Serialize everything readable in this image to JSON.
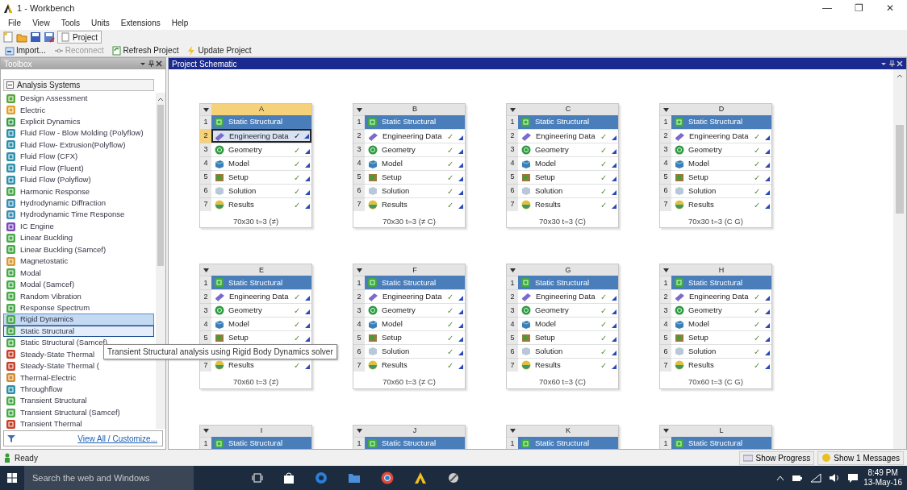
{
  "window": {
    "title": "1 - Workbench",
    "controls": [
      "—",
      "❐",
      "✕"
    ]
  },
  "menu": [
    "File",
    "View",
    "Tools",
    "Units",
    "Extensions",
    "Help"
  ],
  "toolbar": {
    "tab": "Project"
  },
  "project_toolbar": [
    {
      "label": "Import...",
      "disabled": false
    },
    {
      "label": "Reconnect",
      "disabled": true
    },
    {
      "label": "Refresh Project",
      "disabled": false
    },
    {
      "label": "Update Project",
      "disabled": false
    }
  ],
  "toolbox": {
    "title": "Toolbox",
    "group": "Analysis Systems",
    "items": [
      {
        "label": "Design Assessment",
        "color": "#5aa83c",
        "selected": false,
        "hovered": false
      },
      {
        "label": "Electric",
        "color": "#e0a030",
        "selected": false,
        "hovered": false
      },
      {
        "label": "Explicit Dynamics",
        "color": "#3c9a4a",
        "selected": false,
        "hovered": false
      },
      {
        "label": "Fluid Flow - Blow Molding (Polyflow)",
        "color": "#2f8fa8",
        "selected": false,
        "hovered": false
      },
      {
        "label": "Fluid Flow- Extrusion(Polyflow)",
        "color": "#2f8fa8",
        "selected": false,
        "hovered": false
      },
      {
        "label": "Fluid Flow (CFX)",
        "color": "#2f8fa8",
        "selected": false,
        "hovered": false
      },
      {
        "label": "Fluid Flow (Fluent)",
        "color": "#2f8fa8",
        "selected": false,
        "hovered": false
      },
      {
        "label": "Fluid Flow (Polyflow)",
        "color": "#2f8fa8",
        "selected": false,
        "hovered": false
      },
      {
        "label": "Harmonic Response",
        "color": "#4aa84a",
        "selected": false,
        "hovered": false
      },
      {
        "label": "Hydrodynamic Diffraction",
        "color": "#3a8fb0",
        "selected": false,
        "hovered": false
      },
      {
        "label": "Hydrodynamic Time Response",
        "color": "#3a8fb0",
        "selected": false,
        "hovered": false
      },
      {
        "label": "IC Engine",
        "color": "#7a4ab8",
        "selected": false,
        "hovered": false
      },
      {
        "label": "Linear Buckling",
        "color": "#4aa84a",
        "selected": false,
        "hovered": false
      },
      {
        "label": "Linear Buckling (Samcef)",
        "color": "#4aa84a",
        "selected": false,
        "hovered": false
      },
      {
        "label": "Magnetostatic",
        "color": "#d89a38",
        "selected": false,
        "hovered": false
      },
      {
        "label": "Modal",
        "color": "#4aa84a",
        "selected": false,
        "hovered": false
      },
      {
        "label": "Modal (Samcef)",
        "color": "#4aa84a",
        "selected": false,
        "hovered": false
      },
      {
        "label": "Random Vibration",
        "color": "#4aa84a",
        "selected": false,
        "hovered": false
      },
      {
        "label": "Response Spectrum",
        "color": "#4aa84a",
        "selected": false,
        "hovered": false
      },
      {
        "label": "Rigid Dynamics",
        "color": "#4aa84a",
        "selected": false,
        "hovered": true
      },
      {
        "label": "Static Structural",
        "color": "#4aa84a",
        "selected": true,
        "hovered": false
      },
      {
        "label": "Static Structural (Samcef)",
        "color": "#4aa84a",
        "selected": false,
        "hovered": false
      },
      {
        "label": "Steady-State Thermal",
        "color": "#c8402a",
        "selected": false,
        "hovered": false
      },
      {
        "label": "Steady-State Thermal (",
        "color": "#c8402a",
        "selected": false,
        "hovered": false
      },
      {
        "label": "Thermal-Electric",
        "color": "#d08a30",
        "selected": false,
        "hovered": false
      },
      {
        "label": "Throughflow",
        "color": "#2f8fa8",
        "selected": false,
        "hovered": false
      },
      {
        "label": "Transient Structural",
        "color": "#4aa84a",
        "selected": false,
        "hovered": false
      },
      {
        "label": "Transient Structural (Samcef)",
        "color": "#4aa84a",
        "selected": false,
        "hovered": false
      },
      {
        "label": "Transient Thermal",
        "color": "#c8402a",
        "selected": false,
        "hovered": false
      }
    ],
    "footer": "View All / Customize...",
    "tooltip": "Transient Structural analysis using Rigid Body Dynamics solver"
  },
  "schematic": {
    "title": "Project Schematic",
    "systems": [
      {
        "column": "A",
        "selected": true,
        "caption": "70x30 t=3 (≠)",
        "cells": [
          {
            "number": "1",
            "label": "Static Structural",
            "kind": "title",
            "selected": false
          },
          {
            "number": "2",
            "label": "Engineering Data",
            "status": "✓",
            "kind": "engineering_data",
            "selected": true
          },
          {
            "number": "3",
            "label": "Geometry",
            "status": "✓",
            "kind": "geometry",
            "selected": false
          },
          {
            "number": "4",
            "label": "Model",
            "status": "✓",
            "kind": "model",
            "selected": false
          },
          {
            "number": "5",
            "label": "Setup",
            "status": "✓",
            "kind": "setup",
            "selected": false
          },
          {
            "number": "6",
            "label": "Solution",
            "status": "✓",
            "kind": "solution",
            "selected": false
          },
          {
            "number": "7",
            "label": "Results",
            "status": "✓",
            "kind": "results",
            "selected": false
          }
        ]
      },
      {
        "column": "B",
        "selected": false,
        "caption": "70x30 t=3 (≠ C)",
        "cells": [
          {
            "number": "1",
            "label": "Static Structural",
            "kind": "title",
            "selected": false
          },
          {
            "number": "2",
            "label": "Engineering Data",
            "status": "✓",
            "kind": "engineering_data",
            "selected": false
          },
          {
            "number": "3",
            "label": "Geometry",
            "status": "✓",
            "kind": "geometry",
            "selected": false
          },
          {
            "number": "4",
            "label": "Model",
            "status": "✓",
            "kind": "model",
            "selected": false
          },
          {
            "number": "5",
            "label": "Setup",
            "status": "✓",
            "kind": "setup",
            "selected": false
          },
          {
            "number": "6",
            "label": "Solution",
            "status": "✓",
            "kind": "solution",
            "selected": false
          },
          {
            "number": "7",
            "label": "Results",
            "status": "✓",
            "kind": "results",
            "selected": false
          }
        ]
      },
      {
        "column": "C",
        "selected": false,
        "caption": "70x30 t=3 (C)",
        "cells": [
          {
            "number": "1",
            "label": "Static Structural",
            "kind": "title",
            "selected": false
          },
          {
            "number": "2",
            "label": "Engineering Data",
            "status": "✓",
            "kind": "engineering_data",
            "selected": false
          },
          {
            "number": "3",
            "label": "Geometry",
            "status": "✓",
            "kind": "geometry",
            "selected": false
          },
          {
            "number": "4",
            "label": "Model",
            "status": "✓",
            "kind": "model",
            "selected": false
          },
          {
            "number": "5",
            "label": "Setup",
            "status": "✓",
            "kind": "setup",
            "selected": false
          },
          {
            "number": "6",
            "label": "Solution",
            "status": "✓",
            "kind": "solution",
            "selected": false
          },
          {
            "number": "7",
            "label": "Results",
            "status": "✓",
            "kind": "results",
            "selected": false
          }
        ]
      },
      {
        "column": "D",
        "selected": false,
        "caption": "70x30 t=3 (C G)",
        "cells": [
          {
            "number": "1",
            "label": "Static Structural",
            "kind": "title",
            "selected": false
          },
          {
            "number": "2",
            "label": "Engineering Data",
            "status": "✓",
            "kind": "engineering_data",
            "selected": false
          },
          {
            "number": "3",
            "label": "Geometry",
            "status": "✓",
            "kind": "geometry",
            "selected": false
          },
          {
            "number": "4",
            "label": "Model",
            "status": "✓",
            "kind": "model",
            "selected": false
          },
          {
            "number": "5",
            "label": "Setup",
            "status": "✓",
            "kind": "setup",
            "selected": false
          },
          {
            "number": "6",
            "label": "Solution",
            "status": "✓",
            "kind": "solution",
            "selected": false
          },
          {
            "number": "7",
            "label": "Results",
            "status": "✓",
            "kind": "results",
            "selected": false
          }
        ]
      },
      {
        "column": "E",
        "selected": false,
        "caption": "70x60 t=3 (≠)",
        "cells": [
          {
            "number": "1",
            "label": "Static Structural",
            "kind": "title",
            "selected": false
          },
          {
            "number": "2",
            "label": "Engineering Data",
            "status": "✓",
            "kind": "engineering_data",
            "selected": false
          },
          {
            "number": "3",
            "label": "Geometry",
            "status": "✓",
            "kind": "geometry",
            "selected": false
          },
          {
            "number": "4",
            "label": "Model",
            "status": "✓",
            "kind": "model",
            "selected": false
          },
          {
            "number": "5",
            "label": "Setup",
            "status": "✓",
            "kind": "setup",
            "selected": false
          },
          {
            "kind": "covered"
          },
          {
            "number": "7",
            "label": "Results",
            "status": "✓",
            "kind": "results",
            "selected": false
          }
        ]
      },
      {
        "column": "F",
        "selected": false,
        "caption": "70x60 t=3 (≠ C)",
        "cells": [
          {
            "number": "1",
            "label": "Static Structural",
            "kind": "title",
            "selected": false
          },
          {
            "number": "2",
            "label": "Engineering Data",
            "status": "✓",
            "kind": "engineering_data",
            "selected": false
          },
          {
            "number": "3",
            "label": "Geometry",
            "status": "✓",
            "kind": "geometry",
            "selected": false
          },
          {
            "number": "4",
            "label": "Model",
            "status": "✓",
            "kind": "model",
            "selected": false
          },
          {
            "number": "5",
            "label": "Setup",
            "status": "✓",
            "kind": "setup",
            "selected": false
          },
          {
            "number": "6",
            "label": "Solution",
            "status": "✓",
            "kind": "solution",
            "selected": false
          },
          {
            "number": "7",
            "label": "Results",
            "status": "✓",
            "kind": "results",
            "selected": false
          }
        ]
      },
      {
        "column": "G",
        "selected": false,
        "caption": "70x60 t=3 (C)",
        "cells": [
          {
            "number": "1",
            "label": "Static Structural",
            "kind": "title",
            "selected": false
          },
          {
            "number": "2",
            "label": "Engineering Data",
            "status": "✓",
            "kind": "engineering_data",
            "selected": false
          },
          {
            "number": "3",
            "label": "Geometry",
            "status": "✓",
            "kind": "geometry",
            "selected": false
          },
          {
            "number": "4",
            "label": "Model",
            "status": "✓",
            "kind": "model",
            "selected": false
          },
          {
            "number": "5",
            "label": "Setup",
            "status": "✓",
            "kind": "setup",
            "selected": false
          },
          {
            "number": "6",
            "label": "Solution",
            "status": "✓",
            "kind": "solution",
            "selected": false
          },
          {
            "number": "7",
            "label": "Results",
            "status": "✓",
            "kind": "results",
            "selected": false
          }
        ]
      },
      {
        "column": "H",
        "selected": false,
        "caption": "70x60 t=3 (C G)",
        "cells": [
          {
            "number": "1",
            "label": "Static Structural",
            "kind": "title",
            "selected": false
          },
          {
            "number": "2",
            "label": "Engineering Data",
            "status": "✓",
            "kind": "engineering_data",
            "selected": false
          },
          {
            "number": "3",
            "label": "Geometry",
            "status": "✓",
            "kind": "geometry",
            "selected": false
          },
          {
            "number": "4",
            "label": "Model",
            "status": "✓",
            "kind": "model",
            "selected": false
          },
          {
            "number": "5",
            "label": "Setup",
            "status": "✓",
            "kind": "setup",
            "selected": false
          },
          {
            "number": "6",
            "label": "Solution",
            "status": "✓",
            "kind": "solution",
            "selected": false
          },
          {
            "number": "7",
            "label": "Results",
            "status": "✓",
            "kind": "results",
            "selected": false
          }
        ]
      },
      {
        "column": "I",
        "selected": false,
        "cells": [
          {
            "number": "1",
            "label": "Static Structural",
            "kind": "title",
            "selected": false
          }
        ]
      },
      {
        "column": "J",
        "selected": false,
        "cells": [
          {
            "number": "1",
            "label": "Static Structural",
            "kind": "title",
            "selected": false
          }
        ]
      },
      {
        "column": "K",
        "selected": false,
        "cells": [
          {
            "number": "1",
            "label": "Static Structural",
            "kind": "title",
            "selected": false
          }
        ]
      },
      {
        "column": "L",
        "selected": false,
        "cells": [
          {
            "number": "1",
            "label": "Static Structural",
            "kind": "title",
            "selected": false
          }
        ]
      }
    ]
  },
  "status_bar": {
    "text": "Ready",
    "buttons": [
      "Show Progress",
      "Show 1 Messages"
    ]
  },
  "taskbar": {
    "search_placeholder": "Search the web and Windows",
    "time": "8:49 PM",
    "date": "13-May-16"
  }
}
